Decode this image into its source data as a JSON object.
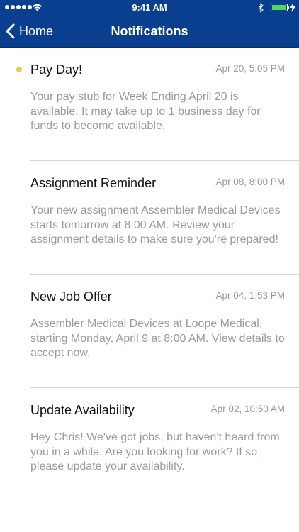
{
  "status_bar": {
    "time": "9:41 AM",
    "signal_icon": "signal-dots-icon",
    "wifi_icon": "wifi-icon",
    "bluetooth_icon": "bluetooth-icon",
    "battery_icon": "battery-icon",
    "charging_icon": "bolt-icon",
    "battery_level": 1.0
  },
  "nav": {
    "back_label": "Home",
    "back_icon": "chevron-left-icon",
    "title": "Notifications"
  },
  "colors": {
    "nav_background": "#0a3f8f",
    "unread_dot": "#f5c842",
    "battery_fill": "#4cd964",
    "secondary_text": "#9a9a9a",
    "separator": "#d6d6d6"
  },
  "notifications": [
    {
      "unread": true,
      "title": "Pay Day!",
      "time": "Apr 20, 5:05 PM",
      "body": "Your pay stub for Week Ending April 20 is available. It may take up to 1 business day for funds to become available."
    },
    {
      "unread": false,
      "title": "Assignment Reminder",
      "time": "Apr 08, 8:00 PM",
      "body": "Your new assignment Assembler Medical Devices starts tomorrow at 8:00 AM.  Review your assignment details to make sure you're prepared!"
    },
    {
      "unread": false,
      "title": "New Job Offer",
      "time": "Apr 04, 1:53 PM",
      "body": "Assembler Medical Devices at Loope Medical, starting Monday, April 9 at 8:00 AM.  View details to accept now."
    },
    {
      "unread": false,
      "title": "Update Availability",
      "time": "Apr 02, 10:50 AM",
      "body": "Hey Chris!  We've got jobs, but haven't heard from you in a while.  Are you looking for work?  If so, please update your availability."
    }
  ]
}
